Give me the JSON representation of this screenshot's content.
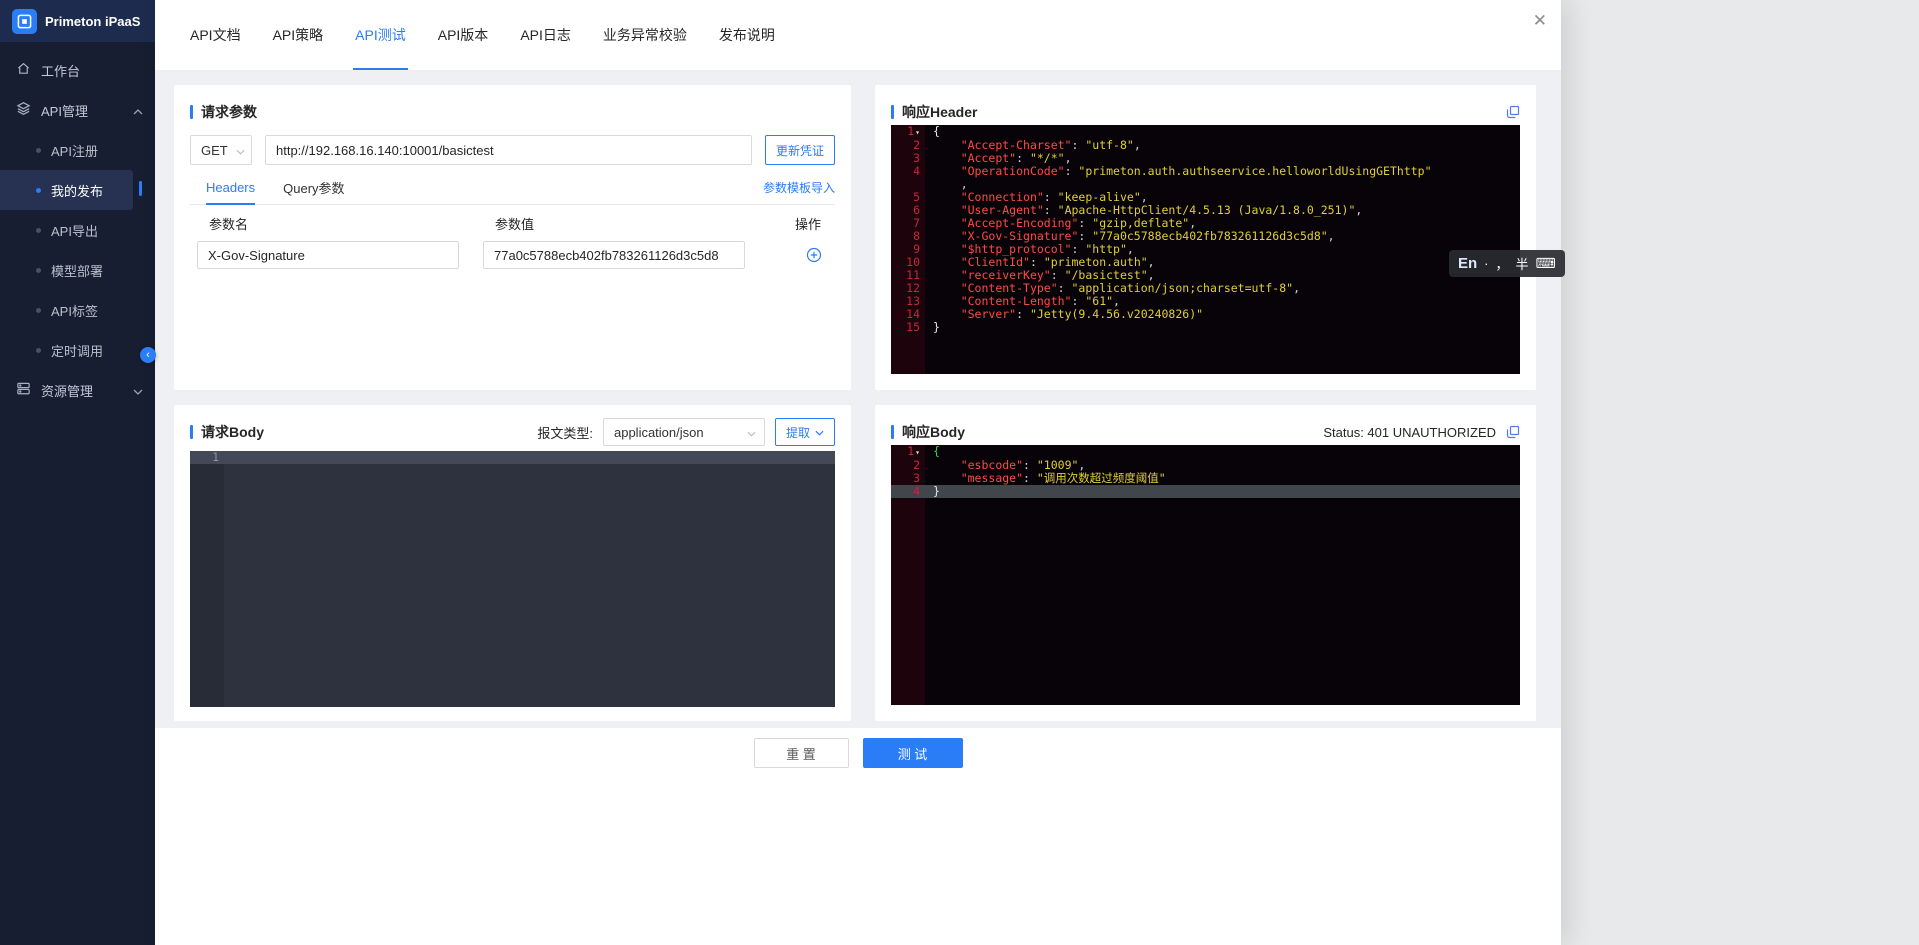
{
  "colors": {
    "accent": "#2b7cf7",
    "sidebar_bg": "#171e31",
    "content_bg": "#eef0f3",
    "editor_bg": "#070309",
    "editor_key": "#ff4a45",
    "editor_string": "#e0d036",
    "editor_line_number": "#c2273d"
  },
  "icons": {
    "close": "✕",
    "fold": "▾",
    "collapse": "‹",
    "keyboard": "⌨"
  },
  "sidebar": {
    "brand": "Primeton iPaaS",
    "workbench": "工作台",
    "api_mgmt": "API管理",
    "resource_mgmt": "资源管理",
    "api_sub": [
      "API注册",
      "我的发布",
      "API导出",
      "模型部署",
      "API标签",
      "定时调用"
    ]
  },
  "tabs": {
    "items": [
      "API文档",
      "API策略",
      "API测试",
      "API版本",
      "API日志",
      "业务异常校验",
      "发布说明"
    ],
    "active": "API测试"
  },
  "request_params": {
    "title": "请求参数",
    "method": "GET",
    "url": "http://192.168.16.140:10001/basictest",
    "update_credential": "更新凭证",
    "subtabs": [
      "Headers",
      "Query参数"
    ],
    "template_import": "参数模板导入",
    "table": {
      "headers": [
        "参数名",
        "参数值",
        "操作"
      ],
      "rows": [
        {
          "name": "X-Gov-Signature",
          "value": "77a0c5788ecb402fb783261126d3c5d8"
        }
      ]
    }
  },
  "request_body": {
    "title": "请求Body",
    "type_label": "报文类型:",
    "content_type": "application/json",
    "extract_label": "提取",
    "lines": [
      {
        "n": "1",
        "active": true,
        "tk": []
      }
    ]
  },
  "response_header": {
    "title": "响应Header",
    "lines": [
      {
        "n": "1",
        "fold": true,
        "tk": [
          [
            "b",
            "{"
          ]
        ]
      },
      {
        "n": "2",
        "tk": [
          [
            "w",
            "    "
          ],
          [
            "k",
            "\"Accept-Charset\""
          ],
          [
            "w",
            ": "
          ],
          [
            "s",
            "\"utf-8\""
          ],
          [
            "w",
            ","
          ]
        ]
      },
      {
        "n": "3",
        "tk": [
          [
            "w",
            "    "
          ],
          [
            "k",
            "\"Accept\""
          ],
          [
            "w",
            ": "
          ],
          [
            "s",
            "\"*/*\""
          ],
          [
            "w",
            ","
          ]
        ]
      },
      {
        "n": "4",
        "tk": [
          [
            "w",
            "    "
          ],
          [
            "k",
            "\"OperationCode\""
          ],
          [
            "w",
            ": "
          ],
          [
            "s",
            "\"primeton.auth.authseervice.helloworldUsingGEThttp\""
          ]
        ]
      },
      {
        "n": "",
        "tk": [
          [
            "w",
            "    ,"
          ]
        ]
      },
      {
        "n": "5",
        "tk": [
          [
            "w",
            "    "
          ],
          [
            "k",
            "\"Connection\""
          ],
          [
            "w",
            ": "
          ],
          [
            "s",
            "\"keep-alive\""
          ],
          [
            "w",
            ","
          ]
        ]
      },
      {
        "n": "6",
        "tk": [
          [
            "w",
            "    "
          ],
          [
            "k",
            "\"User-Agent\""
          ],
          [
            "w",
            ": "
          ],
          [
            "s",
            "\"Apache-HttpClient/4.5.13 (Java/1.8.0_251)\""
          ],
          [
            "w",
            ","
          ]
        ]
      },
      {
        "n": "7",
        "tk": [
          [
            "w",
            "    "
          ],
          [
            "k",
            "\"Accept-Encoding\""
          ],
          [
            "w",
            ": "
          ],
          [
            "s",
            "\"gzip,deflate\""
          ],
          [
            "w",
            ","
          ]
        ]
      },
      {
        "n": "8",
        "tk": [
          [
            "w",
            "    "
          ],
          [
            "k",
            "\"X-Gov-Signature\""
          ],
          [
            "w",
            ": "
          ],
          [
            "s",
            "\"77a0c5788ecb402fb783261126d3c5d8\""
          ],
          [
            "w",
            ","
          ]
        ]
      },
      {
        "n": "9",
        "tk": [
          [
            "w",
            "    "
          ],
          [
            "k",
            "\"$http_protocol\""
          ],
          [
            "w",
            ": "
          ],
          [
            "s",
            "\"http\""
          ],
          [
            "w",
            ","
          ]
        ]
      },
      {
        "n": "10",
        "tk": [
          [
            "w",
            "    "
          ],
          [
            "k",
            "\"ClientId\""
          ],
          [
            "w",
            ": "
          ],
          [
            "s",
            "\"primeton.auth\""
          ],
          [
            "w",
            ","
          ]
        ]
      },
      {
        "n": "11",
        "tk": [
          [
            "w",
            "    "
          ],
          [
            "k",
            "\"receiverKey\""
          ],
          [
            "w",
            ": "
          ],
          [
            "s",
            "\"/basictest\""
          ],
          [
            "w",
            ","
          ]
        ]
      },
      {
        "n": "12",
        "tk": [
          [
            "w",
            "    "
          ],
          [
            "k",
            "\"Content-Type\""
          ],
          [
            "w",
            ": "
          ],
          [
            "s",
            "\"application/json;charset=utf-8\""
          ],
          [
            "w",
            ","
          ]
        ]
      },
      {
        "n": "13",
        "tk": [
          [
            "w",
            "    "
          ],
          [
            "k",
            "\"Content-Length\""
          ],
          [
            "w",
            ": "
          ],
          [
            "s",
            "\"61\""
          ],
          [
            "w",
            ","
          ]
        ]
      },
      {
        "n": "14",
        "tk": [
          [
            "w",
            "    "
          ],
          [
            "k",
            "\"Server\""
          ],
          [
            "w",
            ": "
          ],
          [
            "s",
            "\"Jetty(9.4.56.v20240826)\""
          ]
        ]
      },
      {
        "n": "15",
        "tk": [
          [
            "b",
            "}"
          ]
        ]
      }
    ]
  },
  "response_body": {
    "title": "响应Body",
    "status": "Status: 401 UNAUTHORIZED",
    "lines": [
      {
        "n": "1",
        "fold": true,
        "tk": [
          [
            "g",
            "{"
          ]
        ]
      },
      {
        "n": "2",
        "tk": [
          [
            "w",
            "    "
          ],
          [
            "k",
            "\"esbcode\""
          ],
          [
            "w",
            ": "
          ],
          [
            "s",
            "\"1009\""
          ],
          [
            "w",
            ","
          ]
        ]
      },
      {
        "n": "3",
        "tk": [
          [
            "w",
            "    "
          ],
          [
            "k",
            "\"message\""
          ],
          [
            "w",
            ": "
          ],
          [
            "s",
            "\"调用次数超过频度阈值\""
          ]
        ]
      },
      {
        "n": "4",
        "active": true,
        "tk": [
          [
            "b",
            "}"
          ]
        ]
      }
    ]
  },
  "footer": {
    "reset": "重 置",
    "test": "测 试"
  },
  "ime": {
    "lang": "En",
    "dot": "·",
    "comma": "，",
    "half": "半"
  }
}
